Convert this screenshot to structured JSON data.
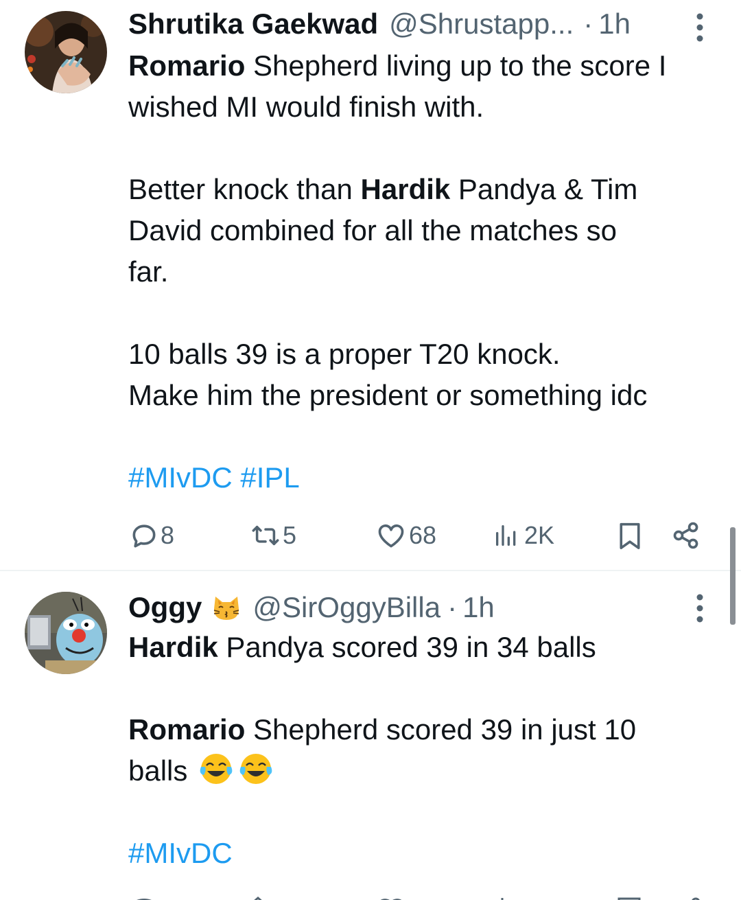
{
  "tweets": [
    {
      "author": "Shrutika Gaekwad",
      "handle": "@Shrustapp...",
      "separator": "·",
      "time": "1h",
      "lines": [
        {
          "bold": "Romario",
          "text": " Shepherd living up to the score I"
        },
        {
          "text": "wished MI would finish with."
        },
        {
          "text": ""
        },
        {
          "text": "Better knock than ",
          "bold": "Hardik",
          "text_after": " Pandya & Tim"
        },
        {
          "text": "David combined for all the matches so"
        },
        {
          "text": "far."
        },
        {
          "text": ""
        },
        {
          "text": "10 balls 39 is a proper T20 knock."
        },
        {
          "text": "Make him the president or something idc"
        },
        {
          "text": ""
        }
      ],
      "hashtags": "#MIvDC #IPL",
      "actions": {
        "replies": "8",
        "retweets": "5",
        "likes": "68",
        "views": "2K"
      }
    },
    {
      "author": "Oggy",
      "author_emoji": "kissing-cat-emoji",
      "handle": "@SirOggyBilla",
      "separator": "·",
      "time": "1h",
      "lines": [
        {
          "bold": "Hardik",
          "text": " Pandya scored 39 in 34 balls"
        },
        {
          "text": ""
        },
        {
          "bold": "Romario",
          "text": " Shepherd scored 39 in just 10"
        },
        {
          "text": "balls",
          "emoji": "joy-emoji-x2"
        },
        {
          "text": ""
        }
      ],
      "hashtags": "#MIvDC"
    }
  ],
  "icons": {
    "reply": "reply-icon",
    "retweet": "retweet-icon",
    "like": "heart-icon",
    "views": "views-icon",
    "bookmark": "bookmark-icon",
    "share": "share-icon",
    "more": "more-options-icon"
  },
  "colors": {
    "text": "#0f1419",
    "secondary": "#536471",
    "link": "#1d9bf0",
    "divider": "#eff3f4"
  }
}
